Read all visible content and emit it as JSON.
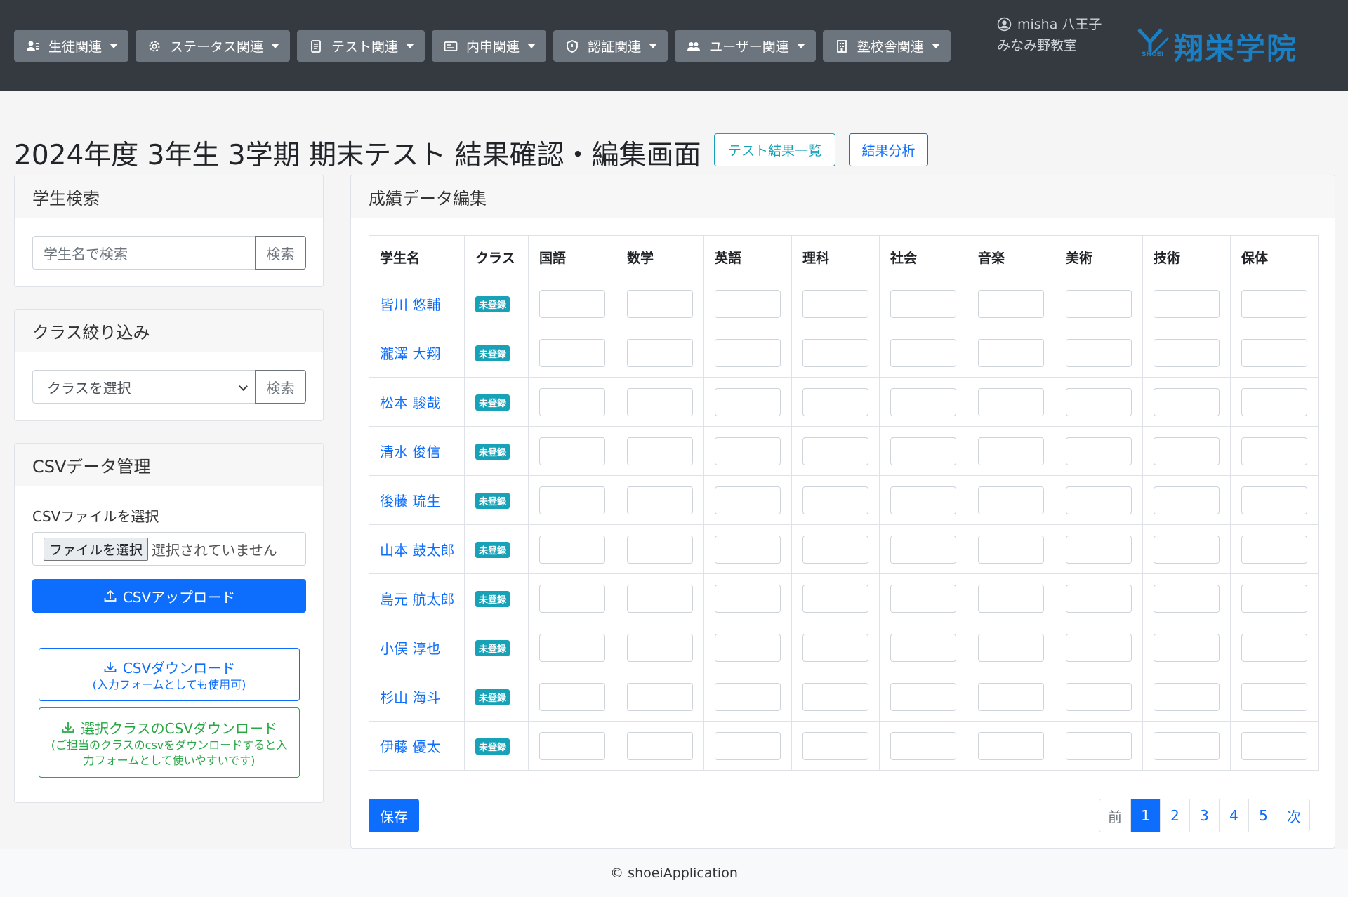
{
  "nav": {
    "menus": [
      {
        "label": "生徒関連",
        "icon": "user-list-icon"
      },
      {
        "label": "ステータス関連",
        "icon": "gear-icon"
      },
      {
        "label": "テスト関連",
        "icon": "document-icon"
      },
      {
        "label": "内申関連",
        "icon": "id-card-icon"
      },
      {
        "label": "認証関連",
        "icon": "shield-icon"
      },
      {
        "label": "ユーザー関連",
        "icon": "users-icon"
      },
      {
        "label": "塾校舎関連",
        "icon": "building-icon"
      }
    ],
    "user_name": "misha 八王子みなみ野教室",
    "logo_text": "翔栄学院",
    "logo_sub": "SHOEI"
  },
  "page": {
    "title": "2024年度 3年生 3学期 期末テスト 結果確認・編集画面",
    "results_list_label": "テスト結果一覧",
    "analysis_label": "結果分析"
  },
  "search_card": {
    "title": "学生検索",
    "placeholder": "学生名で検索",
    "button": "検索"
  },
  "class_card": {
    "title": "クラス絞り込み",
    "selected": "クラスを選択",
    "button": "検索"
  },
  "csv_card": {
    "title": "CSVデータ管理",
    "file_label": "CSVファイルを選択",
    "file_button": "ファイルを選択",
    "file_status": "選択されていません",
    "upload_label": "CSVアップロード",
    "download_label": "CSVダウンロード",
    "download_sub": "(入力フォームとしても使用可)",
    "class_download_label": "選択クラスのCSVダウンロード",
    "class_download_sub": "(ご担当のクラスのcsvをダウンロードすると入力フォームとして使いやすいです)"
  },
  "grades": {
    "title": "成績データ編集",
    "columns": [
      "学生名",
      "クラス",
      "国語",
      "数学",
      "英語",
      "理科",
      "社会",
      "音楽",
      "美術",
      "技術",
      "保体"
    ],
    "status_label": "未登録",
    "students": [
      "皆川 悠輔",
      "瀧澤 大翔",
      "松本 駿哉",
      "清水 俊信",
      "後藤 琉生",
      "山本 鼓太郎",
      "島元 航太郎",
      "小俣 淳也",
      "杉山 海斗",
      "伊藤 優太"
    ],
    "save_label": "保存",
    "pagination": {
      "prev": "前",
      "pages": [
        "1",
        "2",
        "3",
        "4",
        "5"
      ],
      "current": "1",
      "next": "次"
    }
  },
  "footer": {
    "text": "© shoeiApplication"
  },
  "colors": {
    "navbar": "#343a40",
    "primary": "#0d6efd",
    "info": "#17a2b8",
    "success": "#28a745"
  }
}
